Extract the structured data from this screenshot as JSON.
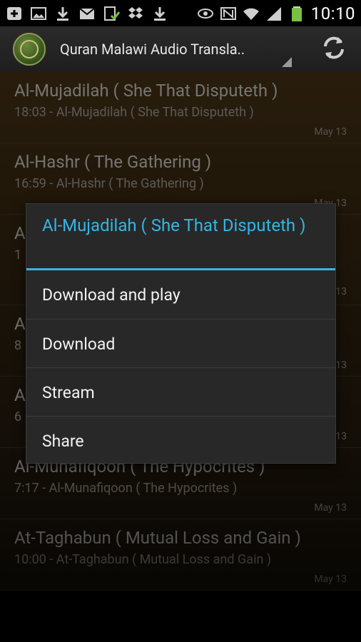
{
  "status_bar": {
    "time": "10:10",
    "left_icons": [
      "plus-icon",
      "image-icon",
      "download-icon",
      "gmail-icon",
      "check-clipboard-icon",
      "dropbox-icon",
      "download-icon"
    ],
    "right_icons": [
      "eye-icon",
      "nfc-icon",
      "wifi-icon",
      "signal-icon",
      "battery-icon"
    ]
  },
  "action_bar": {
    "title": "Quran Malawi Audio Transla..",
    "refresh_icon": "refresh-icon"
  },
  "list": {
    "items": [
      {
        "title": "Al-Mujadilah ( She That Disputeth )",
        "subtitle": "18:03 - Al-Mujadilah ( She That Disputeth )",
        "date": "May 13"
      },
      {
        "title": "Al-Hashr ( The Gathering )",
        "subtitle": "16:59 - Al-Hashr ( The Gathering )",
        "date": "May 13"
      },
      {
        "title": "A",
        "subtitle": "1",
        "date": "May 13"
      },
      {
        "title": "A",
        "subtitle": "8",
        "date": "May 13"
      },
      {
        "title": "A",
        "subtitle": "6",
        "date": "May 13"
      },
      {
        "title": "Al-Munafiqoon ( The Hypocrites )",
        "subtitle": "7:17 - Al-Munafiqoon ( The Hypocrites )",
        "date": "May 13"
      },
      {
        "title": "At-Taghabun ( Mutual Loss and Gain )",
        "subtitle": "10:00 - At-Taghabun ( Mutual Loss and Gain )",
        "date": "May 13"
      }
    ]
  },
  "dialog": {
    "title": "Al-Mujadilah ( She That Disputeth )",
    "options": [
      "Download and play",
      "Download",
      "Stream",
      "Share"
    ]
  },
  "colors": {
    "accent": "#33b5e5",
    "dialog_bg": "#282828"
  }
}
